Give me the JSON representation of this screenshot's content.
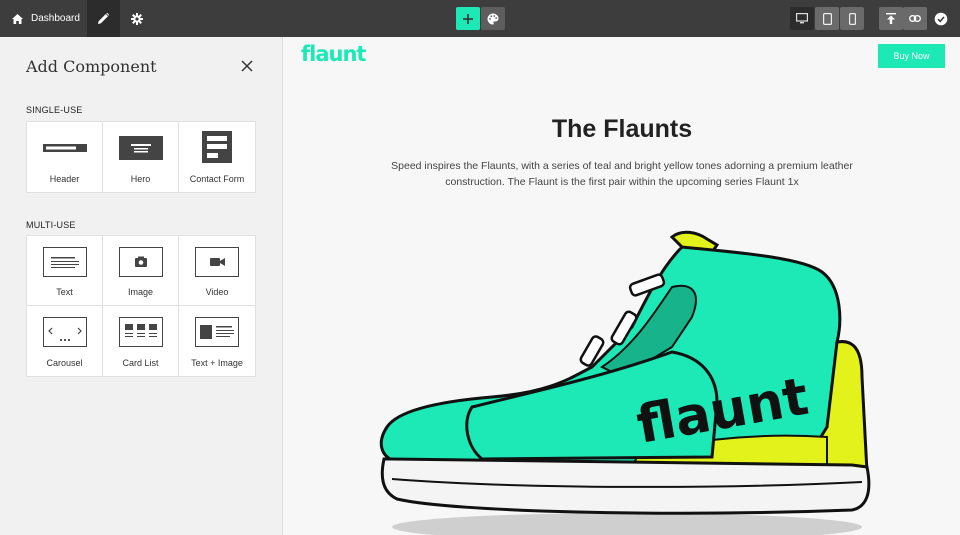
{
  "topbar": {
    "dashboard_label": "Dashboard",
    "icons": [
      "home-icon",
      "pencil-icon",
      "gear-icon",
      "plus-icon",
      "palette-icon",
      "desktop-icon",
      "tablet-icon",
      "mobile-icon",
      "publish-icon",
      "link-icon",
      "check-icon"
    ],
    "accent": "#1de9b6"
  },
  "sidebar": {
    "title": "Add Component",
    "single_label": "SINGLE-USE",
    "multi_label": "MULTI-USE",
    "single_items": [
      "Header",
      "Hero",
      "Contact Form"
    ],
    "multi_items": [
      "Text",
      "Image",
      "Video",
      "Carousel",
      "Card List",
      "Text + Image"
    ]
  },
  "preview": {
    "logo": "flaunt",
    "buy_label": "Buy Now",
    "title": "The Flaunts",
    "description": "Speed inspires the Flaunts, with a series of teal and bright yellow tones adorning a premium leather construction. The Flaunt is the first pair within the upcoming series Flaunt 1x",
    "shoe_logo": "flaunt"
  }
}
